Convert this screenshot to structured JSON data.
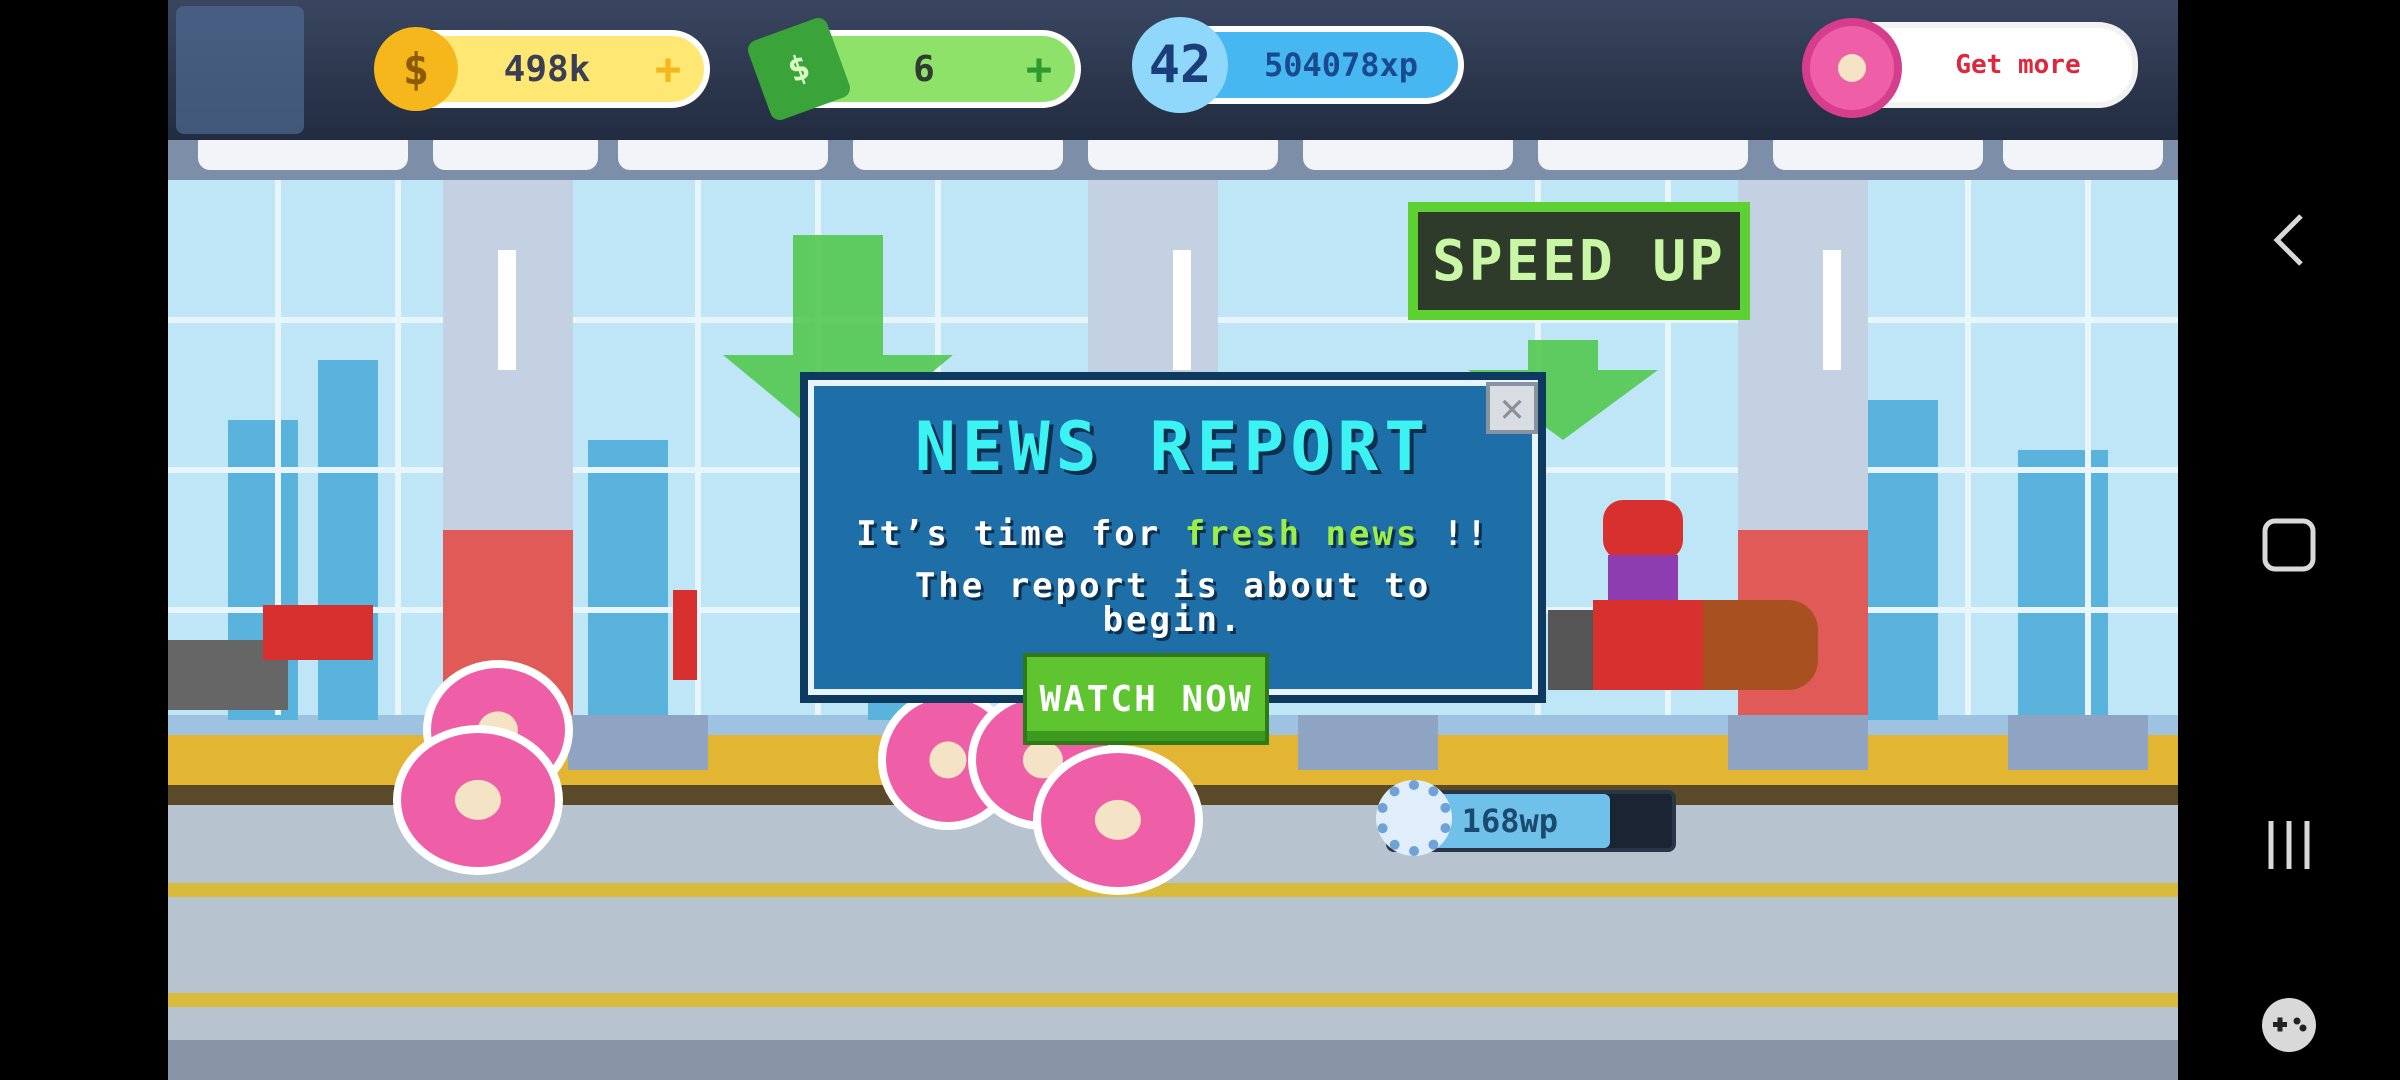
{
  "hud": {
    "coins": "498k",
    "cash": "6",
    "level": "42",
    "xp": "504078xp",
    "donut_cta": "Get more",
    "plus_glyph": "+"
  },
  "speed_up_label": "SPEED UP",
  "modal": {
    "title": "NEWS REPORT",
    "line1_pre": "It’s time for ",
    "line1_highlight": "fresh news",
    "line1_post": " !!",
    "line2": "The report is about to",
    "line3": "begin.",
    "watch_button": "WATCH NOW",
    "close_glyph": "✕"
  },
  "workstation": {
    "wp_label": "168wp",
    "wp_progress": 0.78
  },
  "icons": {
    "coin": "coin-icon",
    "cash": "cash-icon",
    "xp": "xp-level-icon",
    "donut": "donut-icon",
    "gear": "gear-icon",
    "avatar": "avatar-icon"
  },
  "colors": {
    "coin_pill": "#ffe774",
    "cash_pill": "#8ee26a",
    "xp_pill": "#46b7f0",
    "accent_green": "#5ec430",
    "modal_blue": "#1e6fa8",
    "title_cyan": "#3df2f2",
    "donut_pink": "#ee5fa8"
  }
}
